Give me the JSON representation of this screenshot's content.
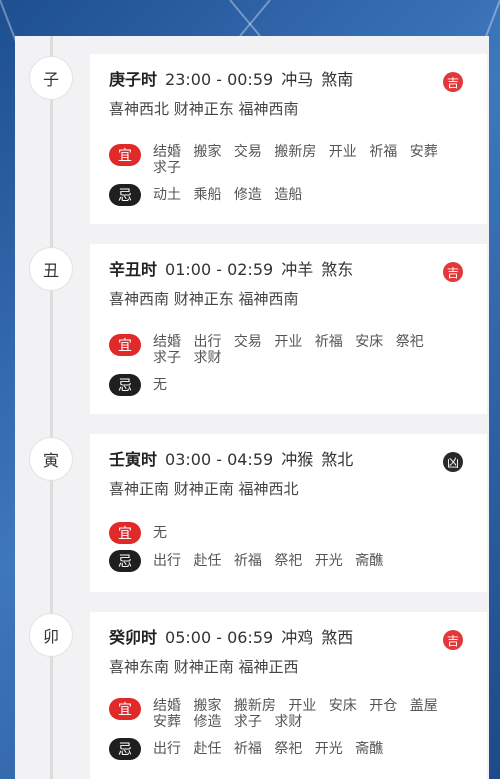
{
  "colors": {
    "yi_pill": "#e02a2a",
    "ji_pill": "#1f1f1f",
    "ji_badge": "#e0383b",
    "xiong_badge": "#2a2a2a"
  },
  "yi_label": "宜",
  "ji_label": "忌",
  "slots": [
    {
      "branch": "子",
      "name": "庚子时",
      "time": "23:00 - 00:59",
      "chong": "冲马",
      "sha": "煞南",
      "shen": "喜神西北 财神正东 福神西南",
      "badge": "吉",
      "badge_type": "ji",
      "yi": "结婚 搬家 交易 搬新房 开业 祈福 安葬 求子",
      "ji": "动土 乘船 修造 造船"
    },
    {
      "branch": "丑",
      "name": "辛丑时",
      "time": "01:00 - 02:59",
      "chong": "冲羊",
      "sha": "煞东",
      "shen": "喜神西南 财神正东 福神西南",
      "badge": "吉",
      "badge_type": "ji",
      "yi": "结婚 出行 交易 开业 祈福 安床 祭祀 求子 求财",
      "ji": "无"
    },
    {
      "branch": "寅",
      "name": "壬寅时",
      "time": "03:00 - 04:59",
      "chong": "冲猴",
      "sha": "煞北",
      "shen": "喜神正南 财神正南 福神西北",
      "badge": "凶",
      "badge_type": "xiong",
      "yi": "无",
      "ji": "出行 赴任 祈福 祭祀 开光 斋醮"
    },
    {
      "branch": "卯",
      "name": "癸卯时",
      "time": "05:00 - 06:59",
      "chong": "冲鸡",
      "sha": "煞西",
      "shen": "喜神东南 财神正南 福神正西",
      "badge": "吉",
      "badge_type": "ji",
      "yi": "结婚 搬家 搬新房 开业 安床 开仓 盖屋 安葬 修造 求子 求财",
      "ji": "出行 赴任 祈福 祭祀 开光 斋醮"
    }
  ]
}
